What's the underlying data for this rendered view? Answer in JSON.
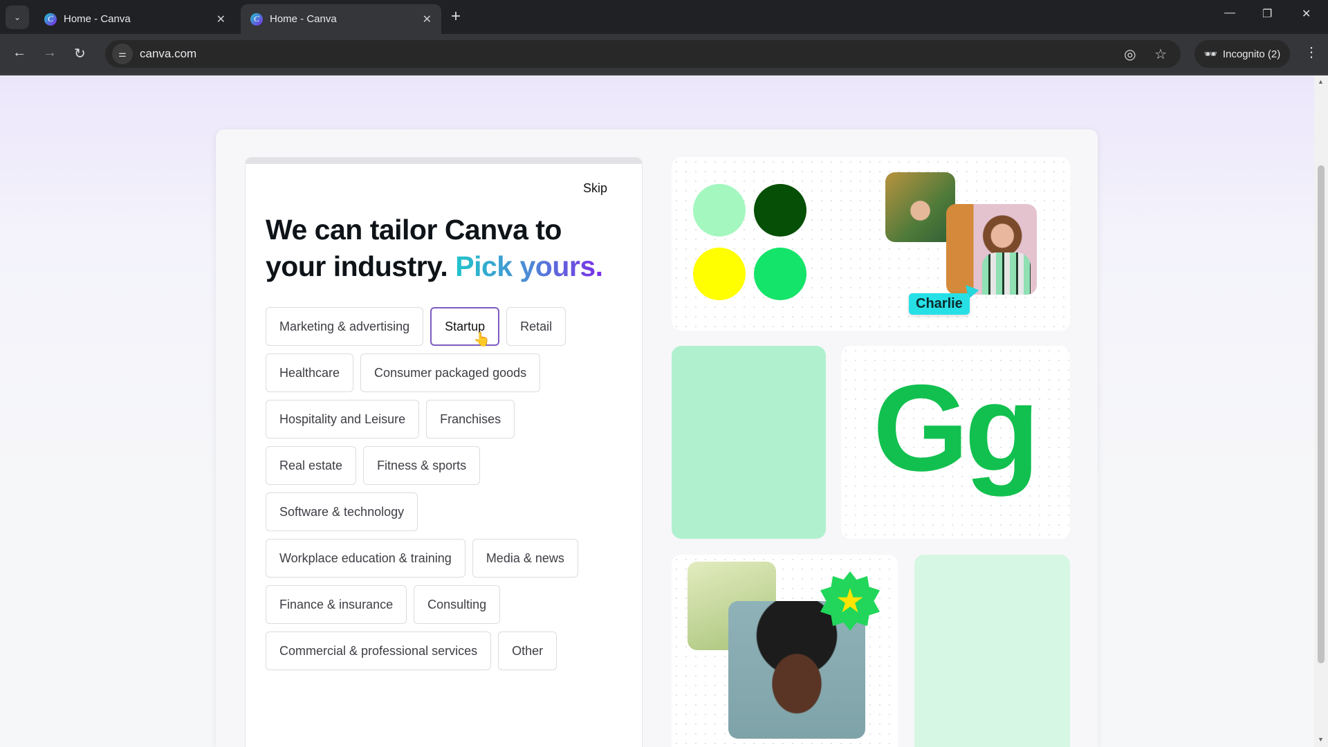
{
  "browser": {
    "tabs": [
      {
        "title": "Home - Canva",
        "active": false
      },
      {
        "title": "Home - Canva",
        "active": true
      }
    ],
    "url": "canva.com",
    "incognito_label": "Incognito (2)",
    "icons": [
      "tab-search-icon",
      "back-icon",
      "forward-icon",
      "reload-icon",
      "site-settings-icon",
      "eye-off-icon",
      "star-icon",
      "incognito-icon",
      "kebab-menu-icon"
    ]
  },
  "onboarding": {
    "skip_label": "Skip",
    "heading_line1": "We can tailor Canva to",
    "heading_line2_plain": "your industry.",
    "heading_highlight": "Pick yours.",
    "selected": "Startup",
    "chip_rows": [
      [
        "Marketing & advertising",
        "Startup",
        "Retail"
      ],
      [
        "Healthcare",
        "Consumer packaged goods"
      ],
      [
        "Hospitality and Leisure",
        "Franchises"
      ],
      [
        "Real estate",
        "Fitness & sports"
      ],
      [
        "Software & technology"
      ],
      [
        "Workplace education & training",
        "Media & news"
      ],
      [
        "Finance & insurance",
        "Consulting"
      ],
      [
        "Commercial & professional services",
        "Other"
      ]
    ]
  },
  "preview": {
    "palette": [
      "#a3f7bf",
      "#064f06",
      "#ffff00",
      "#15e46a"
    ],
    "collaborator_name": "Charlie",
    "font_sample": "Gg",
    "accent_color": "#12c04f",
    "mint_color": "#b1f0cf"
  }
}
